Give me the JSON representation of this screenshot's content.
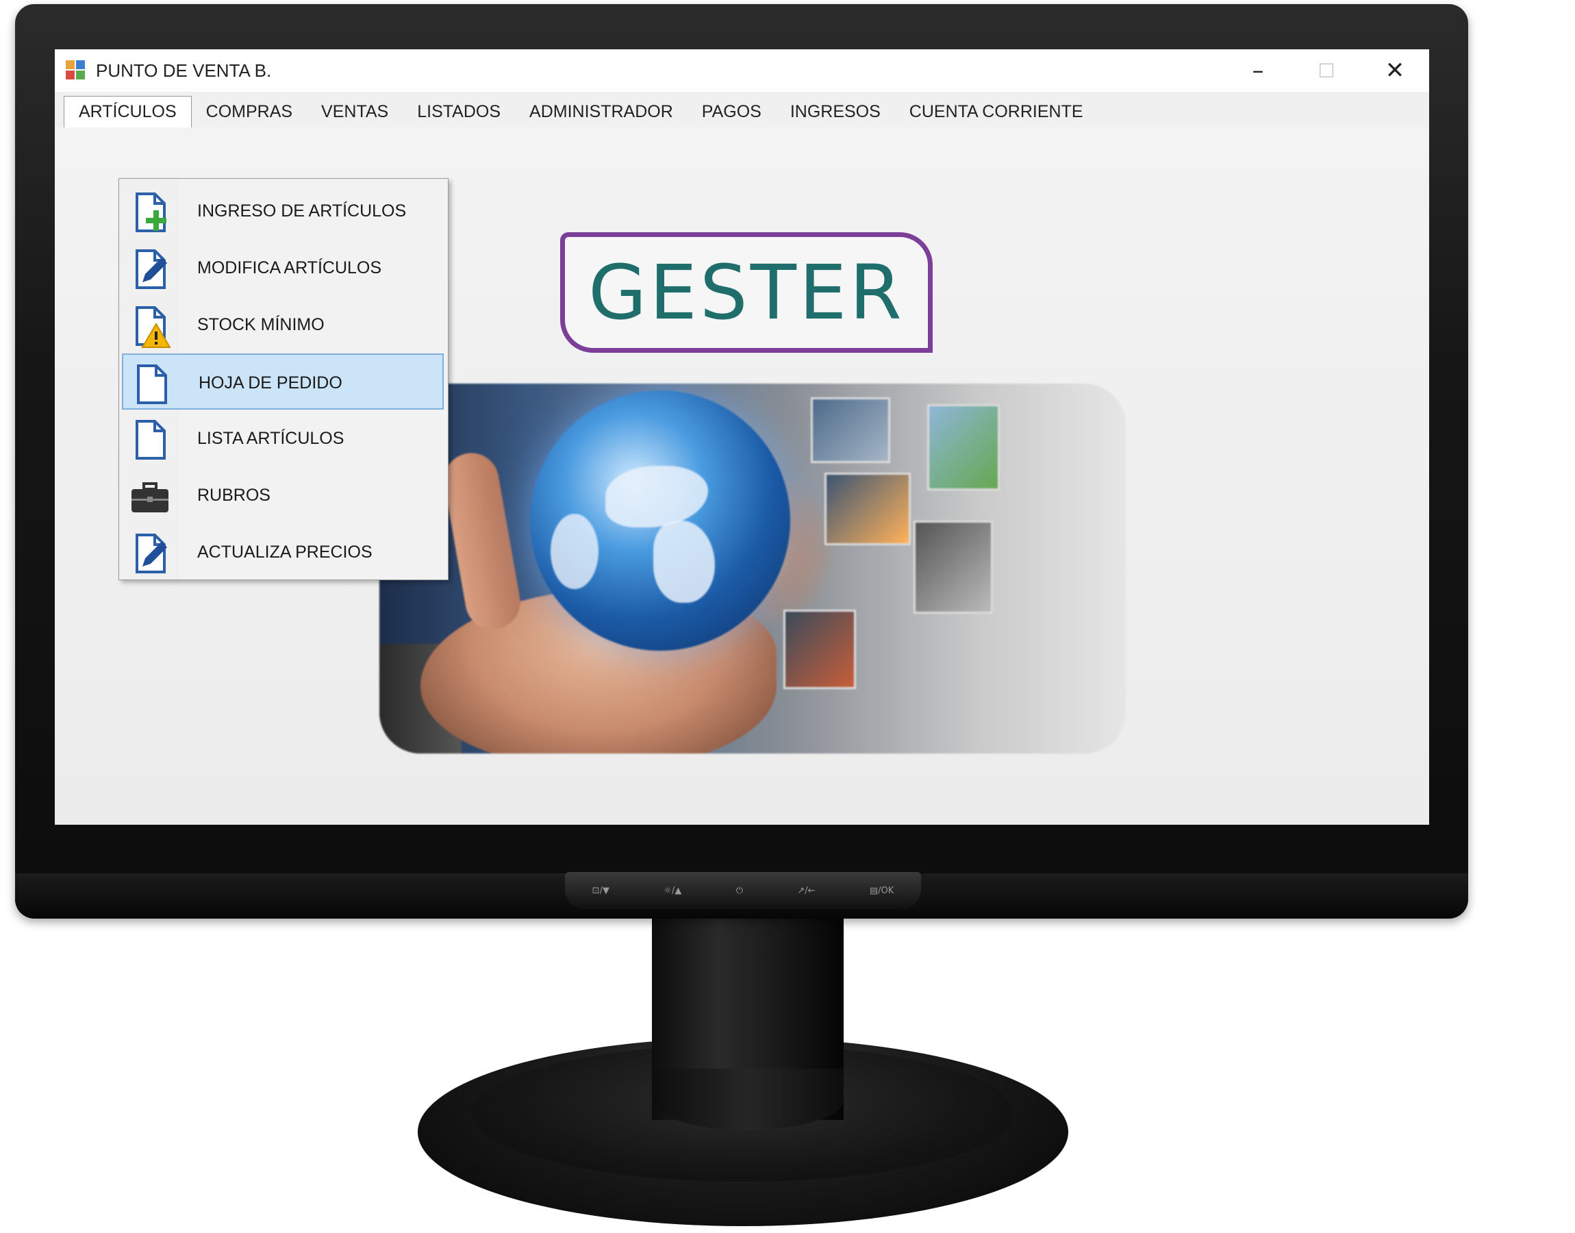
{
  "window": {
    "title": "PUNTO DE VENTA B.",
    "controls": {
      "minimize": "–",
      "maximize": "☐",
      "close": "✕"
    }
  },
  "menubar": {
    "items": [
      {
        "label": "ARTÍCULOS",
        "active": true
      },
      {
        "label": "COMPRAS",
        "active": false
      },
      {
        "label": "VENTAS",
        "active": false
      },
      {
        "label": "LISTADOS",
        "active": false
      },
      {
        "label": "ADMINISTRADOR",
        "active": false
      },
      {
        "label": "PAGOS",
        "active": false
      },
      {
        "label": "INGRESOS",
        "active": false
      },
      {
        "label": "CUENTA CORRIENTE",
        "active": false
      }
    ]
  },
  "dropdown": {
    "items": [
      {
        "label": "INGRESO DE ARTÍCULOS",
        "icon": "document-add-icon"
      },
      {
        "label": "MODIFICA ARTÍCULOS",
        "icon": "document-edit-icon"
      },
      {
        "label": "STOCK MÍNIMO",
        "icon": "document-warning-icon"
      },
      {
        "label": "HOJA DE PEDIDO",
        "icon": "document-icon",
        "selected": true
      },
      {
        "label": "LISTA ARTÍCULOS",
        "icon": "document-icon"
      },
      {
        "label": "RUBROS",
        "icon": "toolbox-icon"
      },
      {
        "label": "ACTUALIZA PRECIOS",
        "icon": "document-edit-icon"
      }
    ]
  },
  "logo": {
    "text": "GESTER"
  },
  "monitor": {
    "buttons": [
      "⊡/▼",
      "☼/▲",
      "⏻",
      "↗/←",
      "▤/OK"
    ]
  },
  "colors": {
    "logo_text": "#1f6e6c",
    "logo_border": "#7b3f98",
    "selection": "#cce4f7",
    "icon_blue": "#2b5fa8",
    "icon_green": "#3aa83a",
    "icon_yellow": "#f2b705"
  }
}
